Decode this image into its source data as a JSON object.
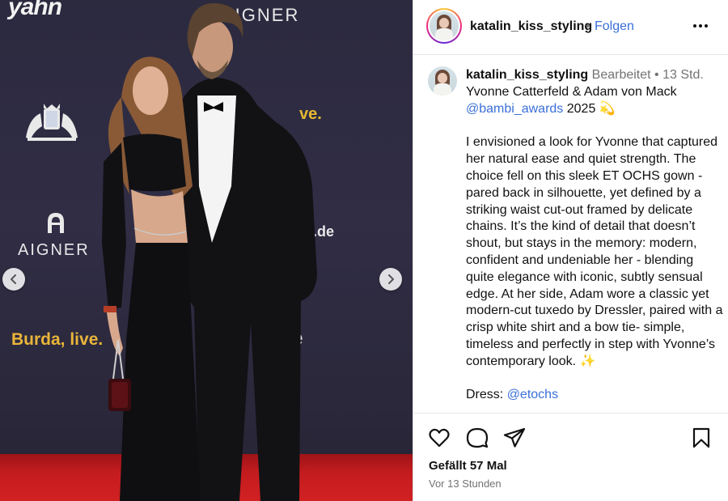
{
  "media": {
    "wall_texts": {
      "yahn": "yahn",
      "aigner_top": "AIGNER",
      "live": "ve.",
      "aigner_left": "AIGNER",
      "n_de": "n.de",
      "burda": "Burda, live.",
      "e": "e"
    },
    "icons": {
      "prev": "chevron-left-icon",
      "next": "chevron-right-icon"
    }
  },
  "header": {
    "username": "katalin_kiss_styling",
    "dot": "•",
    "follow_label": "Folgen",
    "more_icon": "more-horizontal-icon"
  },
  "caption": {
    "username": "katalin_kiss_styling",
    "edited": "Bearbeitet",
    "separator": " • ",
    "time": "13 Std.",
    "title_line": "Yvonne Catterfeld & Adam von Mack",
    "mention": "@bambi_awards",
    "year": "2025",
    "emoji1": "💫",
    "paragraph": "I envisioned a look for Yvonne that captured her natural ease and quiet strength. The choice fell on this sleek ET OCHS gown - pared back in silhouette, yet defined by a striking waist cut-out framed by delicate chains. It’s the kind of detail that doesn’t shout, but stays in the memory: modern, confident and undeniable her - blending quite elegance with iconic, subtly sensual edge. At her side, Adam wore a classic yet modern-cut tuxedo by Dressler, paired with a crisp white shirt and a bow tie- simple, timeless and perfectly in step with Yvonne’s contemporary look.",
    "emoji2": "✨",
    "dress_label": "Dress:",
    "dress_mention": "@etochs"
  },
  "actions": {
    "likes": "Gefällt 57 Mal",
    "time_ago": "Vor 13 Stunden",
    "icons": [
      "heart-icon",
      "comment-icon",
      "share-icon",
      "bookmark-icon"
    ]
  },
  "colors": {
    "link": "#3a6fd8",
    "muted": "#737373",
    "border": "#dbdbdb",
    "backdrop": "#2e2b42",
    "carpet": "#c41c1f"
  }
}
